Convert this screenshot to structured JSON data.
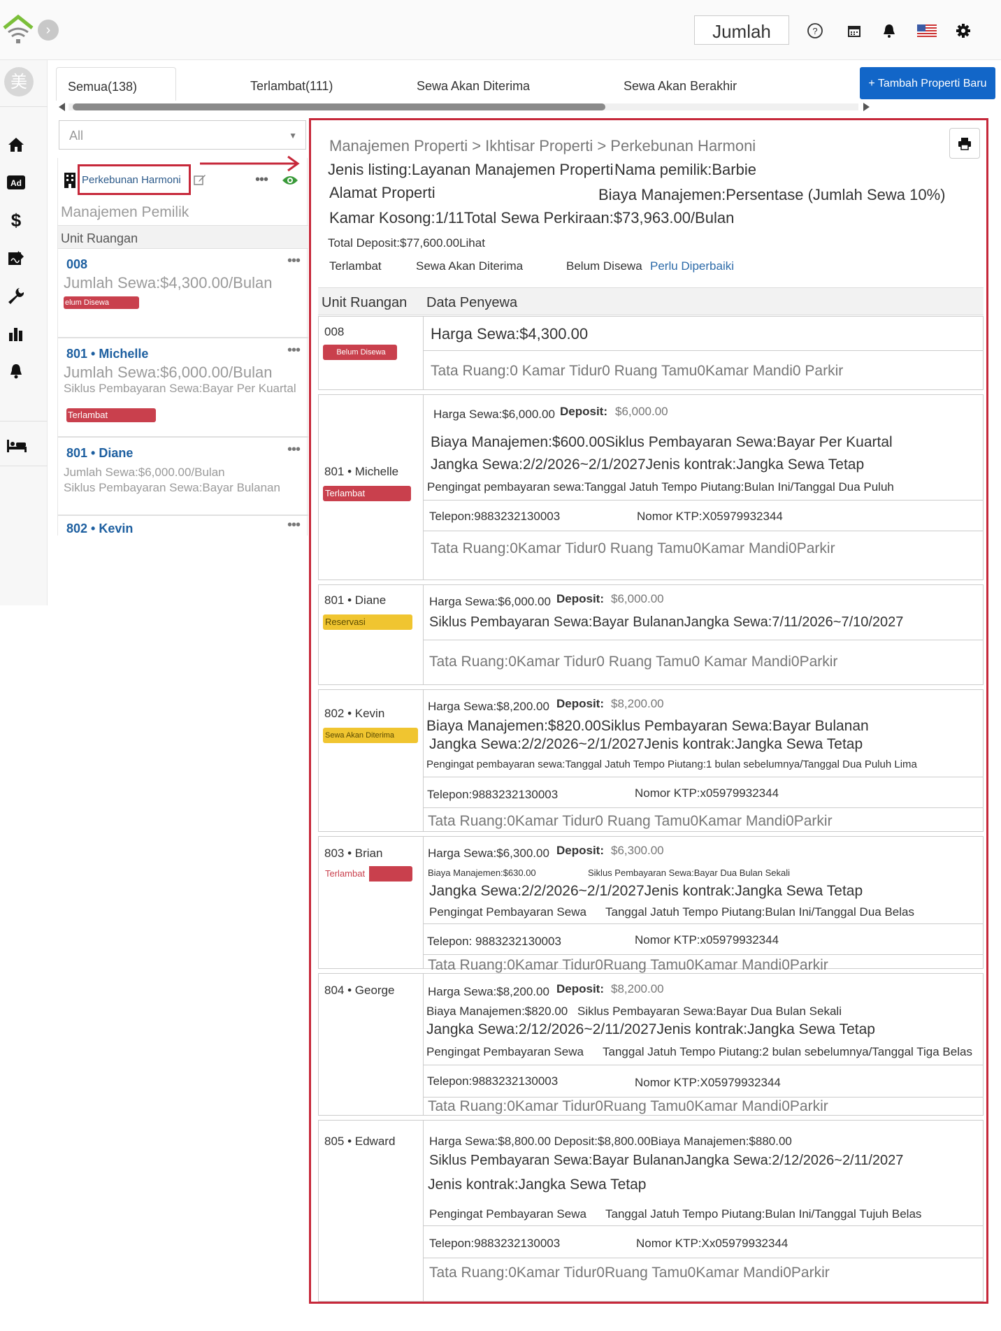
{
  "topbar": {
    "jumlah_label": "Jumlah",
    "icons": [
      "help-icon",
      "calendar-icon",
      "bell-icon",
      "us-flag-icon",
      "settings-icon"
    ]
  },
  "rail": {
    "avatar_text": "美",
    "icons": [
      "home-icon",
      "ad-icon",
      "dollar-icon",
      "signature-icon",
      "wrench-icon",
      "bar-chart-icon",
      "bell-icon",
      "bed-icon"
    ]
  },
  "tabs": [
    {
      "label": "Semua(138)"
    },
    {
      "label": "Terlambat(111)"
    },
    {
      "label": "Sewa Akan Diterima"
    },
    {
      "label": "Sewa Akan Berakhir"
    }
  ],
  "add_button": "+ Tambah Properti Baru",
  "filter": {
    "value": "All"
  },
  "left": {
    "property_name": "Perkebunan Harmoni",
    "owner_mgmt": "Manajemen Pemilik",
    "unit_header": "Unit Ruangan",
    "units": [
      {
        "title": "008",
        "line1": "Jumlah Sewa:$4,300.00/Bulan",
        "badge": "elum Disewa"
      },
      {
        "title": "801 • Michelle",
        "line1": "Jumlah Sewa:$6,000.00/Bulan",
        "line2": "Siklus Pembayaran Sewa:Bayar Per Kuartal",
        "badge": "Terlambat"
      },
      {
        "title": "801 • Diane",
        "line1": "Jumlah Sewa:$6,000.00/Bulan",
        "line2": "Siklus Pembayaran Sewa:Bayar Bulanan"
      },
      {
        "title": "802 • Kevin"
      }
    ]
  },
  "right": {
    "breadcrumb": "Manajemen Properti > Ikhtisar Properti > Perkebunan Harmoni",
    "listing_type": "Jenis listing:Layanan Manajemen Properti",
    "owner_name": "Nama pemilik:Barbie",
    "address": "Alamat Properti",
    "mgmt_fee": "Biaya Manajemen:Persentase (Jumlah Sewa 10%)",
    "vacancy": "Kamar Kosong:1/11Total Sewa Perkiraan:$73,963.00/Bulan",
    "deposit_total": "Total Deposit:$77,600.00Lihat",
    "subtabs": [
      "Terlambat",
      "Sewa Akan Diterima",
      "Belum Disewa"
    ],
    "subtab_link": "Perlu Diperbaiki",
    "table_headers": [
      "Unit Ruangan",
      "Data Penyewa"
    ],
    "rows": [
      {
        "unit": "008",
        "badge": "Belum Disewa",
        "rent": "Harga Sewa:$4,300.00",
        "layout": "Tata Ruang:0 Kamar Tidur0 Ruang Tamu0Kamar Mandi0 Parkir"
      },
      {
        "unit": "801 • Michelle",
        "badge": "Terlambat",
        "rent": "Harga Sewa:$6,000.00",
        "deposit_label": "Deposit:",
        "deposit_value": "$6,000.00",
        "line2": "Biaya Manajemen:$600.00Siklus Pembayaran Sewa:Bayar Per Kuartal",
        "line3": "Jangka Sewa:2/2/2026~2/1/2027Jenis kontrak:Jangka Sewa Tetap",
        "line4": "Pengingat pembayaran sewa:Tanggal Jatuh Tempo Piutang:Bulan Ini/Tanggal Dua Puluh",
        "phone": "Telepon:9883232130003",
        "ktp": "Nomor KTP:X05979932344",
        "layout": "Tata Ruang:0Kamar Tidur0 Ruang Tamu0Kamar Mandi0Parkir"
      },
      {
        "unit": "801 • Diane",
        "badge": "Reservasi",
        "rent": "Harga Sewa:$6,000.00",
        "deposit_label": "Deposit:",
        "deposit_value": "$6,000.00",
        "line2": "Siklus Pembayaran Sewa:Bayar BulananJangka Sewa:7/11/2026~7/10/2027",
        "layout": "Tata Ruang:0Kamar Tidur0 Ruang Tamu0 Kamar Mandi0Parkir"
      },
      {
        "unit": "802 • Kevin",
        "badge": "Sewa Akan Diterima",
        "rent": "Harga Sewa:$8,200.00",
        "deposit_label": "Deposit:",
        "deposit_value": "$8,200.00",
        "line2": "Biaya Manajemen:$820.00Siklus Pembayaran Sewa:Bayar Bulanan",
        "line3": "Jangka Sewa:2/2/2026~2/1/2027Jenis kontrak:Jangka Sewa Tetap",
        "line4": "Pengingat pembayaran sewa:Tanggal Jatuh Tempo Piutang:1 bulan sebelumnya/Tanggal Dua Puluh Lima",
        "phone": "Telepon:9883232130003",
        "ktp": "Nomor KTP:x05979932344",
        "layout": "Tata Ruang:0Kamar Tidur0 Ruang Tamu0Kamar Mandi0Parkir"
      },
      {
        "unit": "803 • Brian",
        "badge": "Terlambat",
        "rent": "Harga Sewa:$6,300.00",
        "deposit_label": "Deposit:",
        "deposit_value": "$6,300.00",
        "line2a": "Biaya Manajemen:$630.00",
        "line2b": "Siklus Pembayaran Sewa:Bayar Dua Bulan Sekali",
        "line3": "Jangka Sewa:2/2/2026~2/1/2027Jenis kontrak:Jangka Sewa Tetap",
        "line4a": "Pengingat Pembayaran Sewa",
        "line4b": "Tanggal Jatuh Tempo Piutang:Bulan Ini/Tanggal Dua Belas",
        "phone": "Telepon: 9883232130003",
        "ktp": "Nomor KTP:x05979932344",
        "layout": "Tata Ruang:0Kamar Tidur0Ruang Tamu0Kamar Mandi0Parkir"
      },
      {
        "unit": "804 • George",
        "rent": "Harga Sewa:$8,200.00",
        "deposit_label": "Deposit:",
        "deposit_value": "$8,200.00",
        "line2a": "Biaya Manajemen:$820.00",
        "line2b": "Siklus Pembayaran Sewa:Bayar Dua Bulan Sekali",
        "line3": "Jangka Sewa:2/12/2026~2/11/2027Jenis kontrak:Jangka Sewa Tetap",
        "line4a": "Pengingat Pembayaran Sewa",
        "line4b": "Tanggal Jatuh Tempo Piutang:2 bulan sebelumnya/Tanggal Tiga Belas",
        "phone": "Telepon:9883232130003",
        "ktp": "Nomor KTP:X05979932344",
        "layout": "Tata Ruang:0Kamar Tidur0Ruang Tamu0Kamar Mandi0Parkir"
      },
      {
        "unit": "805 • Edward",
        "line1": "Harga Sewa:$8,800.00  Deposit:$8,800.00Biaya Manajemen:$880.00",
        "line2": "Siklus Pembayaran Sewa:Bayar BulananJangka Sewa:2/12/2026~2/11/2027",
        "line3": "Jenis kontrak:Jangka Sewa Tetap",
        "line4a": "Pengingat Pembayaran Sewa",
        "line4b": "Tanggal Jatuh Tempo Piutang:Bulan Ini/Tanggal Tujuh Belas",
        "phone": "Telepon:9883232130003",
        "ktp": "Nomor KTP:Xx05979932344",
        "layout": "Tata Ruang:0Kamar Tidur0Ruang Tamu0Kamar Mandi0Parkir"
      }
    ]
  },
  "colors": {
    "accent_red": "#c6283a",
    "primary_blue": "#1266c8",
    "link_blue": "#1d5fa0",
    "badge_red": "#c9404d",
    "badge_yellow": "#f0c530"
  }
}
